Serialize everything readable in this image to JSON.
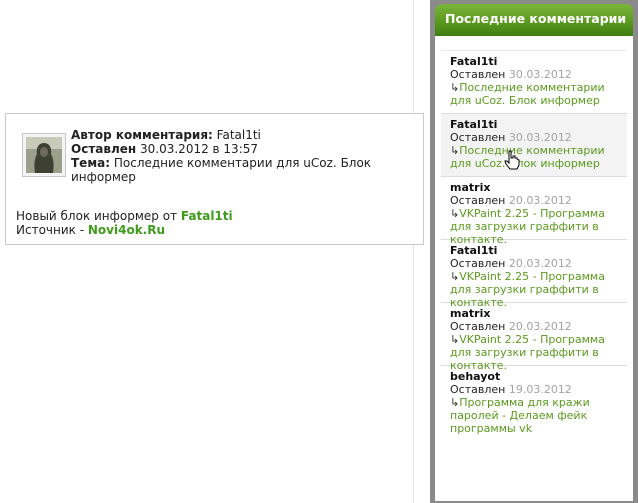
{
  "tooltip": {
    "author_label": "Автор комментария:",
    "author": "Fatal1ti",
    "date_label": "Оставлен",
    "date": "30.03.2012 в 13:57",
    "topic_label": "Тема:",
    "topic": "Последние комментарии для uCoz. Блок информер",
    "line1_text": "Новый блок информер от",
    "line1_link": "Fatal1ti",
    "line2_text": "Источник -",
    "line2_link": "Novi4ok.Ru"
  },
  "widget": {
    "title": "Последние комментарии",
    "items": [
      {
        "author": "Fatal1ti",
        "date_label": "Оставлен",
        "date": "30.03.2012",
        "arrow": "↳",
        "link": "Последние комментарии для uCoz. Блок информер"
      },
      {
        "author": "Fatal1ti",
        "date_label": "Оставлен",
        "date": "30.03.2012",
        "arrow": "↳",
        "link": "Последние комментарии для uCoz. Блок информер"
      },
      {
        "author": "matrix",
        "date_label": "Оставлен",
        "date": "20.03.2012",
        "arrow": "↳",
        "link": "VKPaint 2.25 - Программа для загрузки граффити в контакте."
      },
      {
        "author": "Fatal1ti",
        "date_label": "Оставлен",
        "date": "20.03.2012",
        "arrow": "↳",
        "link": "VKPaint 2.25 - Программа для загрузки граффити в контакте."
      },
      {
        "author": "matrix",
        "date_label": "Оставлен",
        "date": "20.03.2012",
        "arrow": "↳",
        "link": "VKPaint 2.25 - Программа для загрузки граффити в контакте."
      },
      {
        "author": "behayot",
        "date_label": "Оставлен",
        "date": "19.03.2012",
        "arrow": "↳",
        "link": "Программа для кражи паролей - Делаем фейк программы vk"
      }
    ]
  },
  "colors": {
    "accent_green": "#5b9a1f",
    "link_green": "#3f9b1b",
    "date_gray": "#a3a3a3"
  }
}
